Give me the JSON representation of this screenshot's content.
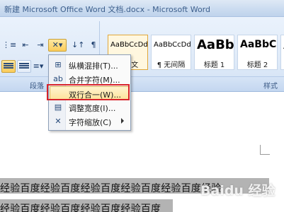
{
  "window": {
    "title": "新建 Microsoft Office Word 文档.docx - Microsoft Word"
  },
  "ribbon": {
    "paragraph_group_label": "段落",
    "styles_group_label": "样式",
    "styles": [
      {
        "sample": "AaBbCcDd",
        "name": "¶ 正文"
      },
      {
        "sample": "AaBbCcDd",
        "name": "¶ 无间隔"
      },
      {
        "sample": "AaBb",
        "name": "标题 1"
      },
      {
        "sample": "AaBbC",
        "name": "标题 2"
      },
      {
        "sample": "A",
        "name": ""
      }
    ]
  },
  "menu": {
    "items": [
      {
        "icon": "vertical-in-horizontal-icon",
        "label": "纵横混排(T)..."
      },
      {
        "icon": "combine-characters-icon",
        "label": "合并字符(M)..."
      },
      {
        "icon": "two-lines-in-one-icon",
        "label": "双行合一(W)..."
      },
      {
        "icon": "fit-text-icon",
        "label": "调整宽度(I)..."
      },
      {
        "icon": "character-scaling-icon",
        "label": "字符缩放(C)"
      }
    ]
  },
  "document": {
    "line1": "经验百度经验百度经验百度经验百度经验百度经验",
    "line2": "经验百度经验百度经验百度经验百度"
  },
  "watermark": "Baidu 经验"
}
